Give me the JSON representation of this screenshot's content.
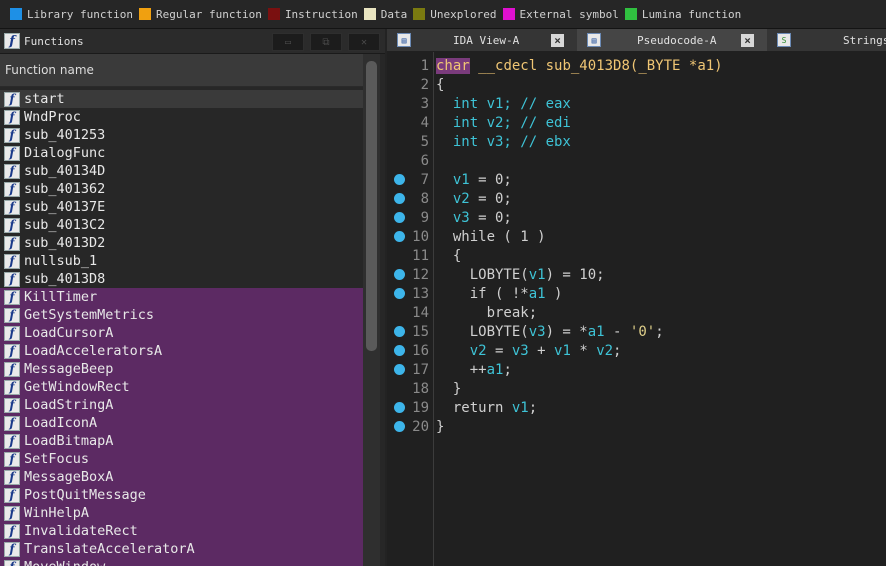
{
  "legend": [
    {
      "label": "Library function",
      "color": "#1e90e6"
    },
    {
      "label": "Regular function",
      "color": "#f0a010"
    },
    {
      "label": "Instruction",
      "color": "#7a1010"
    },
    {
      "label": "Data",
      "color": "#e8e4c0"
    },
    {
      "label": "Unexplored",
      "color": "#7a7a10"
    },
    {
      "label": "External symbol",
      "color": "#e010d0"
    },
    {
      "label": "Lumina function",
      "color": "#30c040"
    }
  ],
  "functions_panel": {
    "title": "Functions",
    "column_header": "Function name",
    "toolbar_icons": [
      "window-icon",
      "restore-icon",
      "close-icon"
    ],
    "items": [
      {
        "name": "start",
        "kind": "regular"
      },
      {
        "name": "WndProc",
        "kind": "regular"
      },
      {
        "name": "sub_401253",
        "kind": "regular"
      },
      {
        "name": "DialogFunc",
        "kind": "regular"
      },
      {
        "name": "sub_40134D",
        "kind": "regular"
      },
      {
        "name": "sub_401362",
        "kind": "regular"
      },
      {
        "name": "sub_40137E",
        "kind": "regular"
      },
      {
        "name": "sub_4013C2",
        "kind": "regular"
      },
      {
        "name": "sub_4013D2",
        "kind": "regular"
      },
      {
        "name": "nullsub_1",
        "kind": "regular"
      },
      {
        "name": "sub_4013D8",
        "kind": "regular"
      },
      {
        "name": "KillTimer",
        "kind": "external"
      },
      {
        "name": "GetSystemMetrics",
        "kind": "external"
      },
      {
        "name": "LoadCursorA",
        "kind": "external"
      },
      {
        "name": "LoadAcceleratorsA",
        "kind": "external"
      },
      {
        "name": "MessageBeep",
        "kind": "external"
      },
      {
        "name": "GetWindowRect",
        "kind": "external"
      },
      {
        "name": "LoadStringA",
        "kind": "external"
      },
      {
        "name": "LoadIconA",
        "kind": "external"
      },
      {
        "name": "LoadBitmapA",
        "kind": "external"
      },
      {
        "name": "SetFocus",
        "kind": "external"
      },
      {
        "name": "MessageBoxA",
        "kind": "external"
      },
      {
        "name": "PostQuitMessage",
        "kind": "external"
      },
      {
        "name": "WinHelpA",
        "kind": "external"
      },
      {
        "name": "InvalidateRect",
        "kind": "external"
      },
      {
        "name": "TranslateAcceleratorA",
        "kind": "external"
      },
      {
        "name": "MoveWindow",
        "kind": "external"
      }
    ]
  },
  "tabs": [
    {
      "label": "IDA View-A",
      "icon": "disassembly-icon",
      "closable": true
    },
    {
      "label": "Pseudocode-A",
      "icon": "pseudocode-icon",
      "closable": true,
      "active": true
    },
    {
      "label": "Strings",
      "icon": "strings-icon",
      "closable": false
    }
  ],
  "code_lines": [
    {
      "n": "1",
      "dot": false,
      "tokens": [
        [
          "cursor",
          "char"
        ],
        [
          "pl",
          " "
        ],
        [
          "fn",
          "__cdecl sub_4013D8("
        ],
        [
          "fn",
          "_BYTE *a1"
        ],
        [
          "fn",
          ")"
        ]
      ]
    },
    {
      "n": "2",
      "dot": false,
      "tokens": [
        [
          "pl",
          "{"
        ]
      ]
    },
    {
      "n": "3",
      "dot": false,
      "tokens": [
        [
          "pl",
          "  "
        ],
        [
          "ty",
          "int v1; // eax"
        ]
      ]
    },
    {
      "n": "4",
      "dot": false,
      "tokens": [
        [
          "pl",
          "  "
        ],
        [
          "ty",
          "int v2; // edi"
        ]
      ]
    },
    {
      "n": "5",
      "dot": false,
      "tokens": [
        [
          "pl",
          "  "
        ],
        [
          "ty",
          "int v3; // ebx"
        ]
      ]
    },
    {
      "n": "6",
      "dot": false,
      "tokens": []
    },
    {
      "n": "7",
      "dot": true,
      "tokens": [
        [
          "pl",
          "  "
        ],
        [
          "id",
          "v1"
        ],
        [
          "pl",
          " = 0;"
        ]
      ]
    },
    {
      "n": "8",
      "dot": true,
      "tokens": [
        [
          "pl",
          "  "
        ],
        [
          "id",
          "v2"
        ],
        [
          "pl",
          " = 0;"
        ]
      ]
    },
    {
      "n": "9",
      "dot": true,
      "tokens": [
        [
          "pl",
          "  "
        ],
        [
          "id",
          "v3"
        ],
        [
          "pl",
          " = 0;"
        ]
      ]
    },
    {
      "n": "10",
      "dot": true,
      "tokens": [
        [
          "pl",
          "  while ( 1 )"
        ]
      ]
    },
    {
      "n": "11",
      "dot": false,
      "tokens": [
        [
          "pl",
          "  {"
        ]
      ]
    },
    {
      "n": "12",
      "dot": true,
      "tokens": [
        [
          "pl",
          "    LOBYTE("
        ],
        [
          "id",
          "v1"
        ],
        [
          "pl",
          ") = 10;"
        ]
      ]
    },
    {
      "n": "13",
      "dot": true,
      "tokens": [
        [
          "pl",
          "    if ( !*"
        ],
        [
          "id",
          "a1"
        ],
        [
          "pl",
          " )"
        ]
      ]
    },
    {
      "n": "14",
      "dot": false,
      "tokens": [
        [
          "pl",
          "      break;"
        ]
      ]
    },
    {
      "n": "15",
      "dot": true,
      "tokens": [
        [
          "pl",
          "    LOBYTE("
        ],
        [
          "id",
          "v3"
        ],
        [
          "pl",
          ") = *"
        ],
        [
          "id",
          "a1"
        ],
        [
          "pl",
          " - "
        ],
        [
          "str",
          "'0'"
        ],
        [
          "pl",
          ";"
        ]
      ]
    },
    {
      "n": "16",
      "dot": true,
      "tokens": [
        [
          "pl",
          "    "
        ],
        [
          "id",
          "v2"
        ],
        [
          "pl",
          " = "
        ],
        [
          "id",
          "v3"
        ],
        [
          "pl",
          " + "
        ],
        [
          "id",
          "v1"
        ],
        [
          "pl",
          " * "
        ],
        [
          "id",
          "v2"
        ],
        [
          "pl",
          ";"
        ]
      ]
    },
    {
      "n": "17",
      "dot": true,
      "tokens": [
        [
          "pl",
          "    ++"
        ],
        [
          "id",
          "a1"
        ],
        [
          "pl",
          ";"
        ]
      ]
    },
    {
      "n": "18",
      "dot": false,
      "tokens": [
        [
          "pl",
          "  }"
        ]
      ]
    },
    {
      "n": "19",
      "dot": true,
      "tokens": [
        [
          "pl",
          "  return "
        ],
        [
          "id",
          "v1"
        ],
        [
          "pl",
          ";"
        ]
      ]
    },
    {
      "n": "20",
      "dot": true,
      "tokens": [
        [
          "pl",
          "}"
        ]
      ]
    }
  ]
}
